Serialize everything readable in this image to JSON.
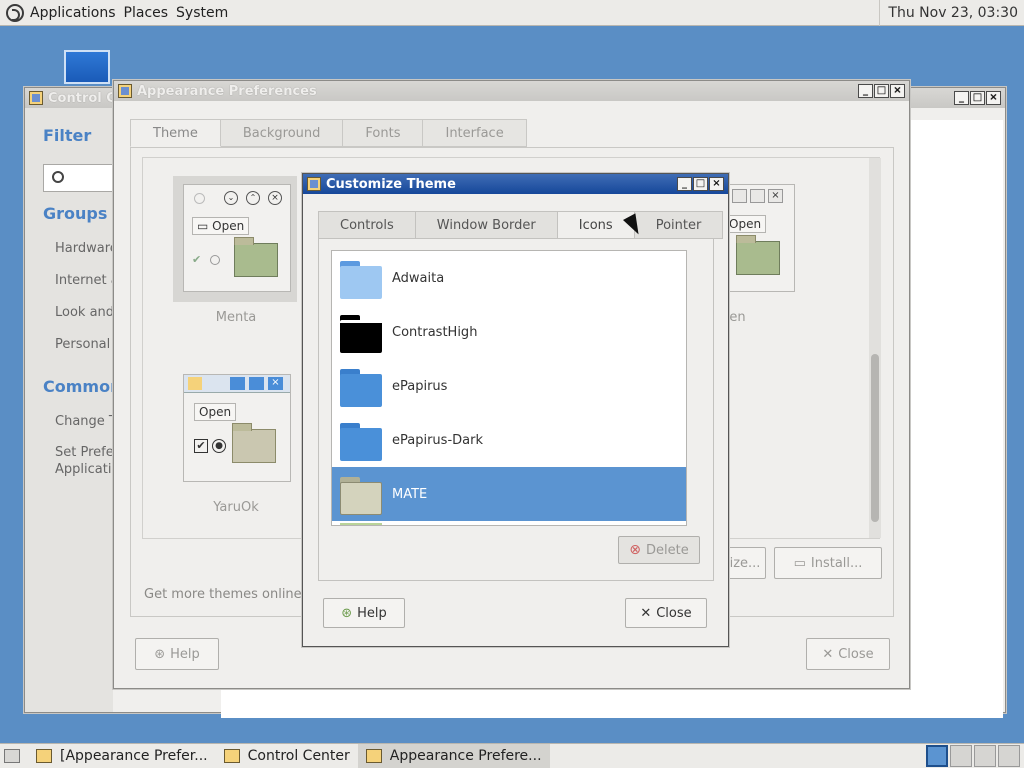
{
  "top_panel": {
    "menus": [
      "Applications",
      "Places",
      "System"
    ],
    "clock": "Thu Nov 23, 03:30"
  },
  "control_center": {
    "title": "Control Ce",
    "filter_heading": "Filter",
    "groups_heading": "Groups",
    "groups": [
      "Hardware",
      "Internet a",
      "Look and",
      "Personal"
    ],
    "common_heading": "Common",
    "common": [
      "Change T",
      "Set Prefer",
      "Applicatio"
    ],
    "window_buttons": [
      "_",
      "□",
      "×"
    ]
  },
  "appearance": {
    "title": "Appearance Preferences",
    "tabs": [
      "Theme",
      "Background",
      "Fonts",
      "Interface"
    ],
    "themes": [
      {
        "name": "Menta",
        "button": "Open"
      },
      {
        "name": "uGreen",
        "button": "Open"
      },
      {
        "name": "YaruOk",
        "button": "Open"
      }
    ],
    "get_more": "Get more themes online",
    "customize_button": "ize...",
    "install_button": "Install...",
    "help_button": "Help",
    "close_button": "Close",
    "window_buttons": [
      "_",
      "□",
      "×"
    ]
  },
  "customize": {
    "title": "Customize Theme",
    "tabs": [
      "Controls",
      "Window Border",
      "Icons",
      "Pointer"
    ],
    "icon_themes": [
      {
        "name": "Adwaita",
        "color": "#6aa8e8"
      },
      {
        "name": "ContrastHigh",
        "color": "#000000"
      },
      {
        "name": "ePapirus",
        "color": "#4a90d9"
      },
      {
        "name": "ePapirus-Dark",
        "color": "#4a90d9"
      },
      {
        "name": "MATE",
        "color": "#c6c6ad"
      }
    ],
    "selected": "MATE",
    "delete_button": "Delete",
    "help_button": "Help",
    "close_button": "Close",
    "window_buttons": [
      "_",
      "□",
      "×"
    ]
  },
  "taskbar": {
    "tasks": [
      "[Appearance Prefer...",
      "Control Center",
      "Appearance Prefere..."
    ]
  }
}
